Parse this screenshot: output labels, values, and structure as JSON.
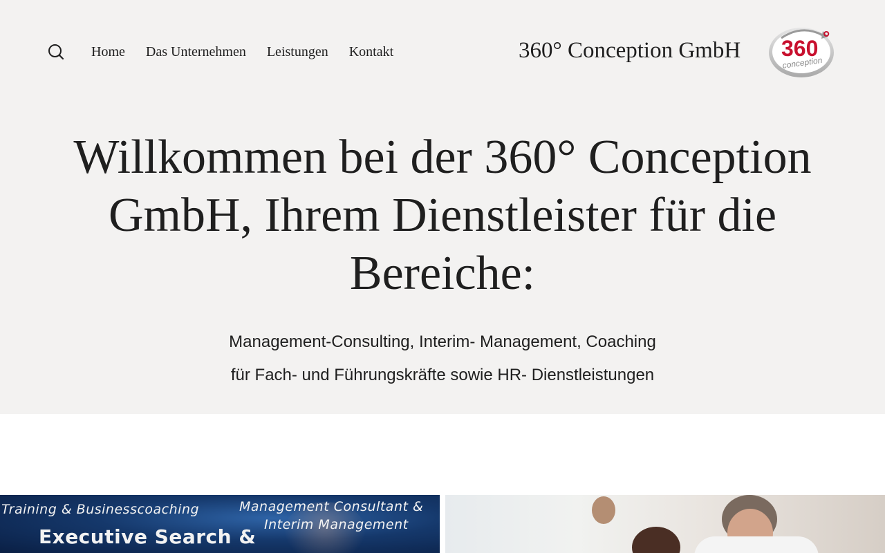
{
  "header": {
    "search": {
      "icon": "search-icon"
    },
    "nav": [
      {
        "label": "Home"
      },
      {
        "label": "Das Unternehmen"
      },
      {
        "label": "Leistungen"
      },
      {
        "label": "Kontakt"
      }
    ],
    "brand_name": "360° Conception GmbH",
    "logo": {
      "number": "360",
      "degree": "°",
      "word": "conception",
      "colors": {
        "accent": "#c8102e",
        "ring": "#b8b8b8"
      }
    }
  },
  "hero": {
    "headline": "Willkommen bei der 360° Conception GmbH, Ihrem Dienstleister für die Bereiche:",
    "subline_1": "Management-Consulting, Interim- Management, Coaching",
    "subline_2": "für Fach- und Führungskräfte sowie HR- Dienstleistungen",
    "background": "#f3f2f1"
  },
  "tiles": [
    {
      "name": "services-collage",
      "texts": [
        "Training & Businesscoaching",
        "Management Consultant &",
        "Interim Management",
        "Executive Search &"
      ]
    },
    {
      "name": "team-photo"
    }
  ]
}
